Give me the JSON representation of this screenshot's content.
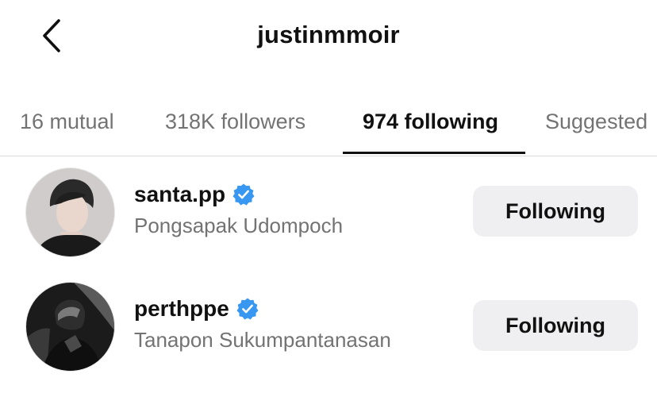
{
  "header": {
    "title": "justinmmoir",
    "back_icon": "chevron-left-icon"
  },
  "tabs": [
    {
      "label": "16 mutual",
      "active": false
    },
    {
      "label": "318K followers",
      "active": false
    },
    {
      "label": "974 following",
      "active": true
    },
    {
      "label": "Suggested",
      "active": false
    }
  ],
  "accounts": [
    {
      "username": "santa.pp",
      "full_name": "Pongsapak Udompoch",
      "verified": true,
      "button_label": "Following",
      "avatar_icon": "profile-photo"
    },
    {
      "username": "perthppe",
      "full_name": "Tanapon Sukumpantanasan",
      "verified": true,
      "button_label": "Following",
      "avatar_icon": "profile-photo"
    }
  ],
  "colors": {
    "verified_blue": "#3897f0",
    "secondary_text": "#737373",
    "button_bg": "#efeff1",
    "divider": "#dbdbdb"
  }
}
